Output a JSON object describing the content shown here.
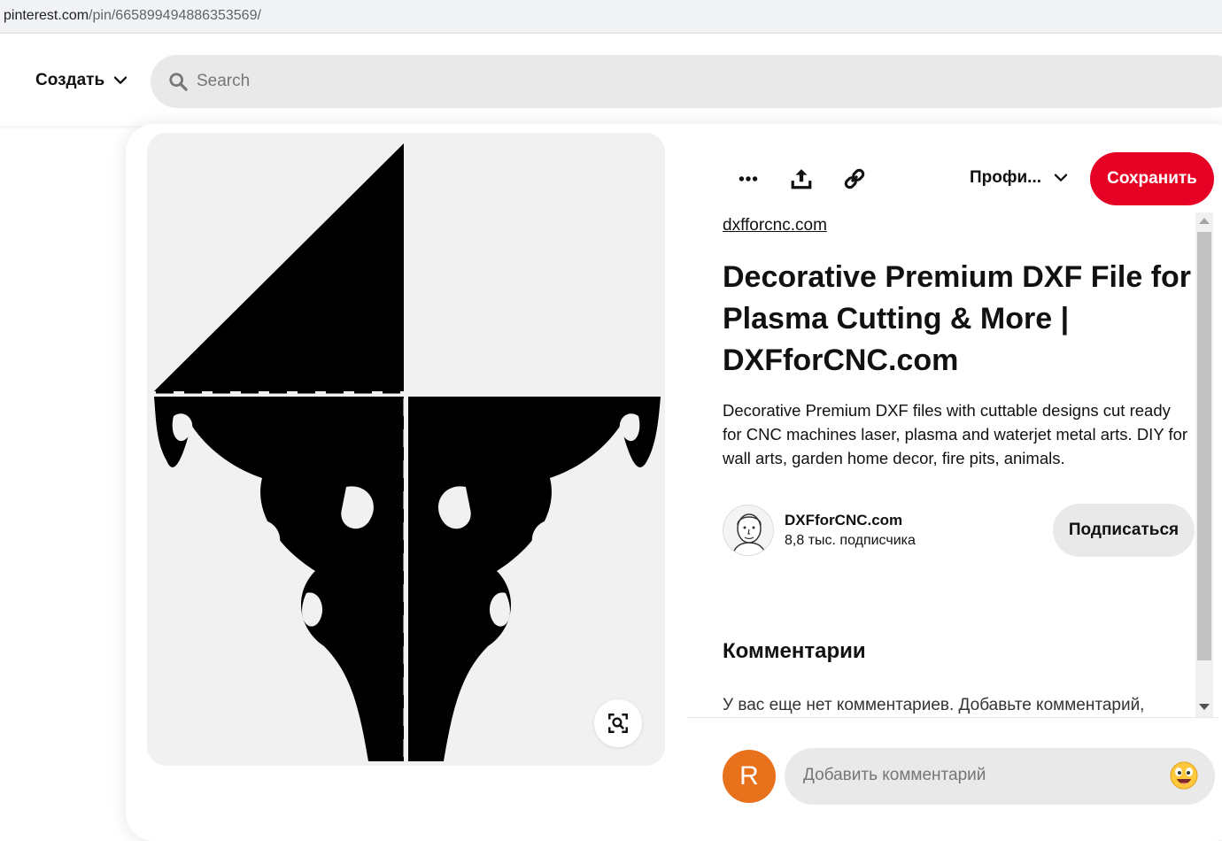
{
  "browser": {
    "url_host": "pinterest.com",
    "url_path": "/pin/665899494886353569/"
  },
  "header": {
    "create_label": "Создать",
    "search_placeholder": "Search"
  },
  "pin": {
    "toolbar": {
      "more_icon": "ellipsis-icon",
      "share_icon": "share-upload-icon",
      "link_icon": "link-icon",
      "board_label": "Профи...",
      "save_label": "Сохранить"
    },
    "source_link": "dxfforcnc.com",
    "title": "Decorative Premium DXF File for Plasma Cutting & More | DXFforCNC.com",
    "description": "Decorative Premium DXF files with cuttable designs cut ready for CNC machines laser, plasma and waterjet metal arts. DIY for wall arts, garden home decor, fire pits, animals.",
    "author": {
      "name": "DXFforCNC.com",
      "followers": "8,8 тыс. подписчика",
      "subscribe_label": "Подписаться"
    },
    "comments": {
      "heading": "Комментарии",
      "empty_text": "У вас еще нет комментариев. Добавьте комментарий,",
      "user_initial": "R",
      "input_placeholder": "Добавить комментарий"
    }
  },
  "colors": {
    "save_button": "#e60023",
    "user_avatar": "#e8711c",
    "pill_gray": "#e9e9e9"
  }
}
